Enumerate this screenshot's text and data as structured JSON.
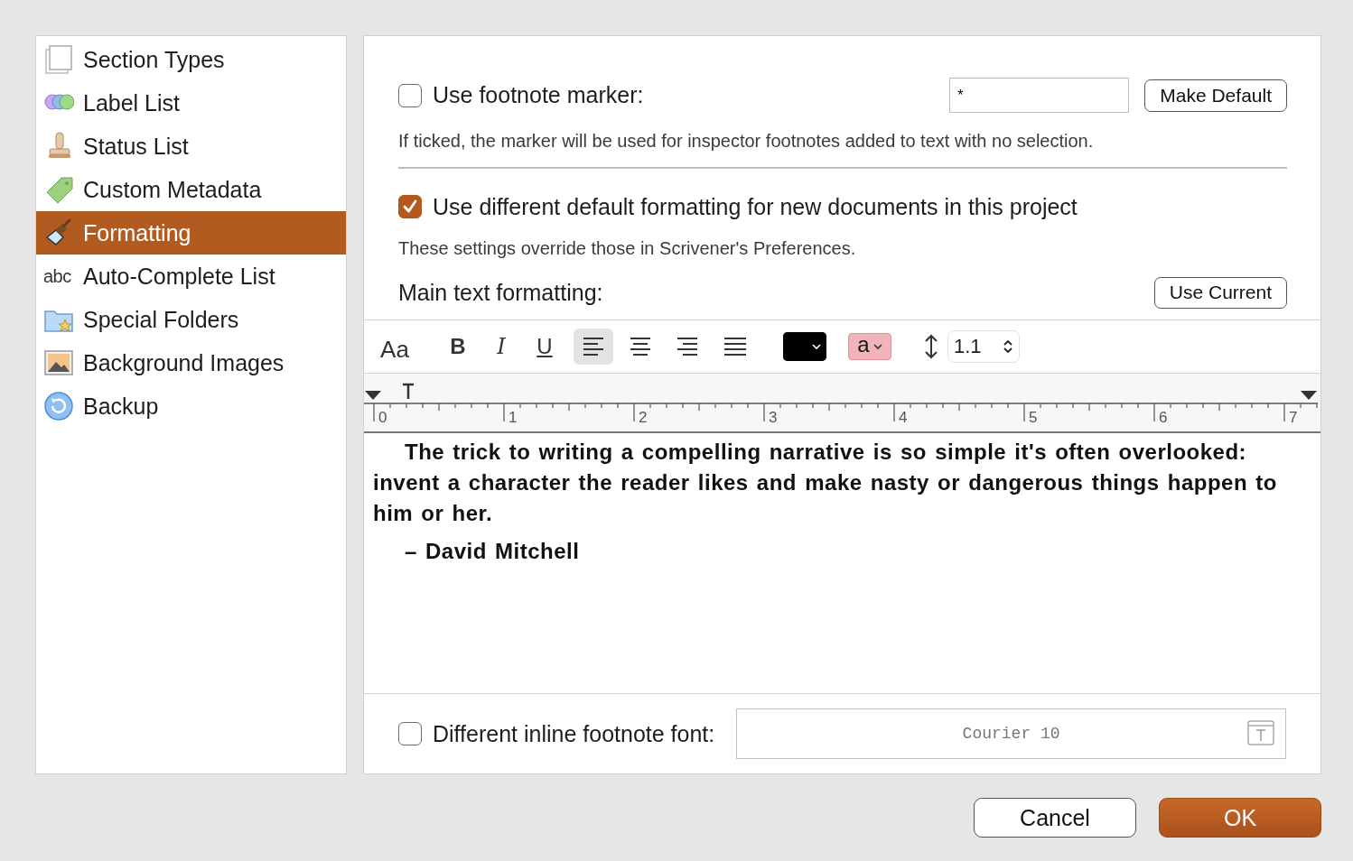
{
  "sidebar": {
    "items": [
      {
        "label": "Section Types",
        "kind": "pages",
        "selected": false
      },
      {
        "label": "Label List",
        "kind": "circles",
        "selected": false
      },
      {
        "label": "Status List",
        "kind": "stamp",
        "selected": false
      },
      {
        "label": "Custom Metadata",
        "kind": "tag",
        "selected": false
      },
      {
        "label": "Formatting",
        "kind": "brush",
        "selected": true
      },
      {
        "label": "Auto-Complete List",
        "kind": "abc",
        "icon_text": "abc",
        "selected": false
      },
      {
        "label": "Special Folders",
        "kind": "folder",
        "selected": false
      },
      {
        "label": "Background Images",
        "kind": "image",
        "selected": false
      },
      {
        "label": "Backup",
        "kind": "backup",
        "selected": false
      }
    ]
  },
  "footnote_marker": {
    "label": "Use footnote marker:",
    "checked": false,
    "value": "*",
    "button": "Make Default",
    "note": "If ticked, the marker will be used for inspector footnotes added to text with no selection."
  },
  "default_formatting": {
    "label": "Use different default formatting for new documents in this project",
    "checked": true,
    "note": "These settings override those in Scrivener's Preferences."
  },
  "main_text_formatting": {
    "label": "Main text formatting:",
    "button": "Use Current"
  },
  "toolbar": {
    "font_button": "Aa",
    "styles": [
      {
        "label": "B",
        "kind": "bold"
      },
      {
        "label": "I",
        "kind": "italic"
      },
      {
        "label": "U",
        "kind": "underline"
      }
    ],
    "alignments": [
      {
        "kind": "left",
        "selected": true
      },
      {
        "kind": "center",
        "selected": false
      },
      {
        "kind": "right",
        "selected": false
      },
      {
        "kind": "justify",
        "selected": false
      }
    ],
    "text_color": {
      "color": "#000000"
    },
    "highlight": {
      "label": "a",
      "color": "#f2b3bb"
    },
    "line_spacing": "1.1"
  },
  "ruler": {
    "labels": [
      "0",
      "1",
      "2",
      "3",
      "4",
      "5",
      "6",
      "7"
    ]
  },
  "editor": {
    "paragraphs": [
      "The trick to writing a compelling narrative is so simple it's often overlooked: invent a character the reader likes and make nasty or dangerous things happen to him or her.",
      "– David Mitchell"
    ]
  },
  "inline_footnote": {
    "label": "Different inline footnote font:",
    "checked": false,
    "font": "Courier 10"
  },
  "buttons": [
    {
      "label": "Cancel",
      "kind": "secondary"
    },
    {
      "label": "OK",
      "kind": "default"
    }
  ]
}
